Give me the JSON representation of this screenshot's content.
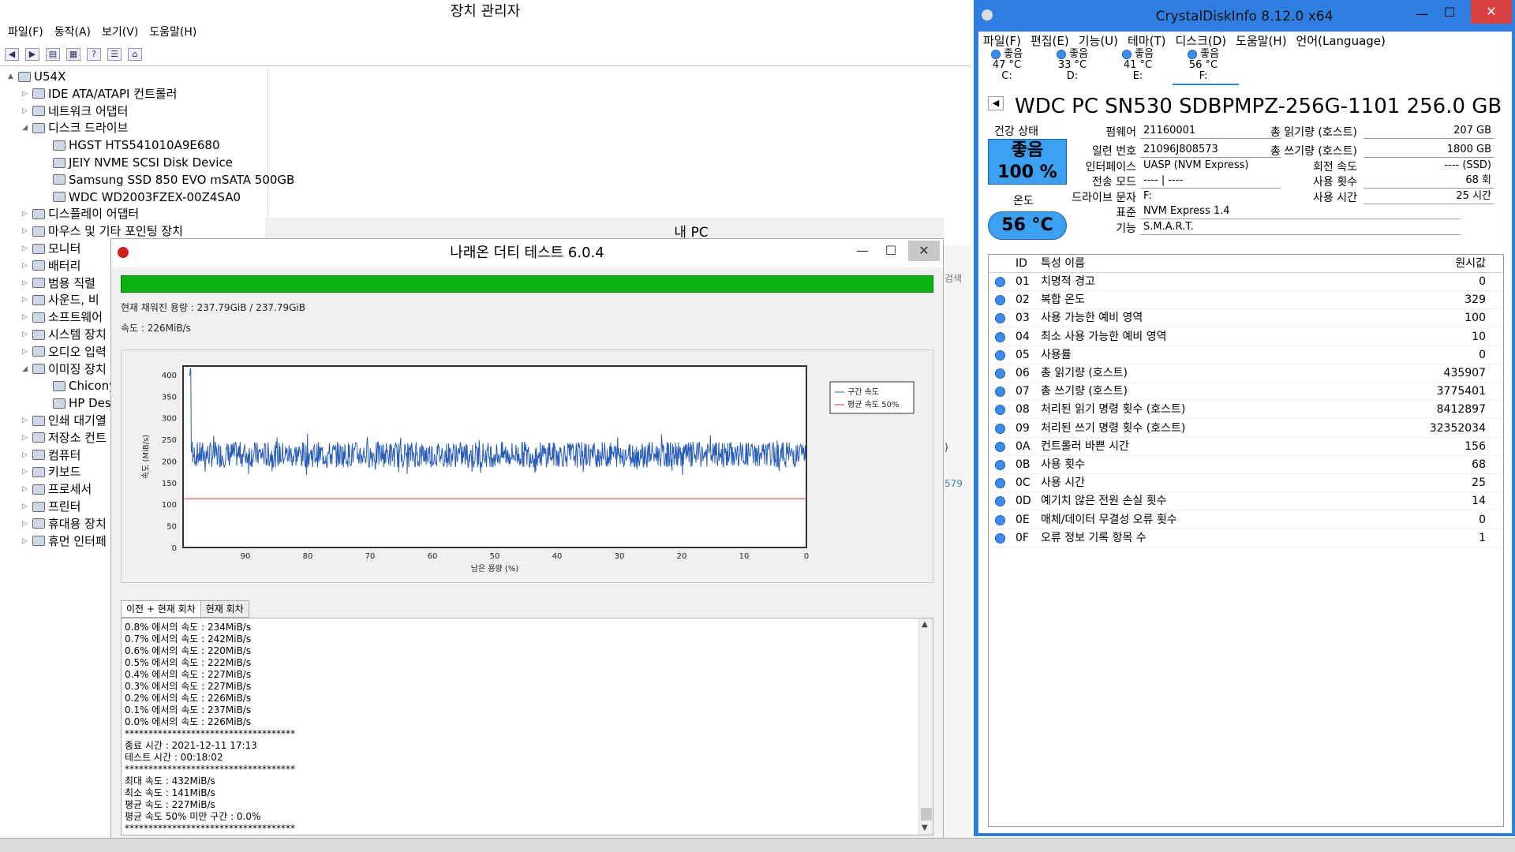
{
  "dm": {
    "title": "장치 관리자",
    "menu": [
      "파일(F)",
      "동작(A)",
      "보기(V)",
      "도움말(H)"
    ],
    "tree": [
      {
        "label": "U54X",
        "lvl": 0,
        "exp": "▲"
      },
      {
        "label": "IDE ATA/ATAPI 컨트롤러",
        "lvl": 1,
        "exp": "▷"
      },
      {
        "label": "네트워크 어댑터",
        "lvl": 1,
        "exp": "▷"
      },
      {
        "label": "디스크 드라이브",
        "lvl": 1,
        "exp": "◢"
      },
      {
        "label": "HGST HTS541010A9E680",
        "lvl": 2,
        "exp": ""
      },
      {
        "label": "JEIY NVME SCSI Disk Device",
        "lvl": 2,
        "exp": ""
      },
      {
        "label": "Samsung SSD 850 EVO mSATA 500GB",
        "lvl": 2,
        "exp": ""
      },
      {
        "label": "WDC WD2003FZEX-00Z4SA0",
        "lvl": 2,
        "exp": ""
      },
      {
        "label": "디스플레이 어댑터",
        "lvl": 1,
        "exp": "▷"
      },
      {
        "label": "마우스 및 기타 포인팅 장치",
        "lvl": 1,
        "exp": "▷"
      },
      {
        "label": "모니터",
        "lvl": 1,
        "exp": "▷"
      },
      {
        "label": "배터리",
        "lvl": 1,
        "exp": "▷"
      },
      {
        "label": "범용 직렬",
        "lvl": 1,
        "exp": "▷"
      },
      {
        "label": "사운드, 비",
        "lvl": 1,
        "exp": "▷"
      },
      {
        "label": "소프트웨어",
        "lvl": 1,
        "exp": "▷"
      },
      {
        "label": "시스템 장치",
        "lvl": 1,
        "exp": "▷"
      },
      {
        "label": "오디오 입력",
        "lvl": 1,
        "exp": "▷"
      },
      {
        "label": "이미징 장치",
        "lvl": 1,
        "exp": "◢"
      },
      {
        "label": "Chicony",
        "lvl": 2,
        "exp": ""
      },
      {
        "label": "HP Desk",
        "lvl": 2,
        "exp": ""
      },
      {
        "label": "인쇄 대기열",
        "lvl": 1,
        "exp": "▷"
      },
      {
        "label": "저장소 컨트",
        "lvl": 1,
        "exp": "▷"
      },
      {
        "label": "컴퓨터",
        "lvl": 1,
        "exp": "▷"
      },
      {
        "label": "키보드",
        "lvl": 1,
        "exp": "▷"
      },
      {
        "label": "프로세서",
        "lvl": 1,
        "exp": "▷"
      },
      {
        "label": "프린터",
        "lvl": 1,
        "exp": "▷"
      },
      {
        "label": "휴대용 장치",
        "lvl": 1,
        "exp": "▷"
      },
      {
        "label": "휴먼 인터페",
        "lvl": 1,
        "exp": "▷"
      }
    ]
  },
  "mypc": {
    "title": "내 PC",
    "side_text1": "검색",
    "side_text2": ")",
    "side_text3": "579"
  },
  "test": {
    "title": "나래온 더티 테스트 6.0.4",
    "filled": "현재 채워진 용량 : 237.79GiB / 237.79GiB",
    "speed": "속도 : 226MiB/s",
    "tabs": [
      "이전 + 현재 회차",
      "현재 회차"
    ],
    "log": [
      "0.8% 에서의 속도 : 234MiB/s",
      "0.7% 에서의 속도 : 242MiB/s",
      "0.6% 에서의 속도 : 220MiB/s",
      "0.5% 에서의 속도 : 222MiB/s",
      "0.4% 에서의 속도 : 227MiB/s",
      "0.3% 에서의 속도 : 227MiB/s",
      "0.2% 에서의 속도 : 226MiB/s",
      "0.1% 에서의 속도 : 237MiB/s",
      "0.0% 에서의 속도 : 226MiB/s",
      "************************************",
      "종료 시간 : 2021-12-11 17:13",
      "테스트 시간 : 00:18:02",
      "************************************",
      "최대 속도 : 432MiB/s",
      "최소 속도 : 141MiB/s",
      "평균 속도 : 227MiB/s",
      "평균 속도 50% 미만 구간 : 0.0%",
      "************************************"
    ]
  },
  "chart_data": {
    "type": "line",
    "xlabel": "남은 용량 (%)",
    "ylabel": "속도 (MiB/s)",
    "xlim": [
      100,
      0
    ],
    "ylim": [
      0,
      420
    ],
    "xticks": [
      90,
      80,
      70,
      60,
      50,
      40,
      30,
      20,
      10,
      0
    ],
    "yticks": [
      0,
      50,
      100,
      150,
      200,
      250,
      300,
      350,
      400
    ],
    "series": [
      {
        "name": "구간 속도",
        "color": "#2a5db8",
        "description_values": {
          "initial": 420,
          "steady_low": 185,
          "steady_high": 245,
          "steady_mean": 215
        }
      },
      {
        "name": "평균 속도 50%",
        "color": "#e03030",
        "values": [
          113
        ]
      }
    ],
    "legend": "right"
  },
  "cdi": {
    "title": "CrystalDiskInfo 8.12.0 x64",
    "menu": [
      "파일(F)",
      "편집(E)",
      "기능(U)",
      "테마(T)",
      "디스크(D)",
      "도움말(H)",
      "언어(Language)"
    ],
    "drives": [
      {
        "status": "좋음",
        "temp": "47 °C",
        "letter": "C:"
      },
      {
        "status": "좋음",
        "temp": "33 °C",
        "letter": "D:"
      },
      {
        "status": "좋음",
        "temp": "41 °C",
        "letter": "E:"
      },
      {
        "status": "좋음",
        "temp": "56 °C",
        "letter": "F:"
      }
    ],
    "model": "WDC PC SN530 SDBPMPZ-256G-1101 256.0 GB",
    "health_label": "건강 상태",
    "health_status": "좋음",
    "health_pct": "100 %",
    "temp_label": "온도",
    "temp": "56 °C",
    "fields": {
      "fw_l": "펌웨어",
      "fw": "21160001",
      "sn_l": "일련 번호",
      "sn": "21096J808573",
      "if_l": "인터페이스",
      "if": "UASP (NVM Express)",
      "tm_l": "전송 모드",
      "tm": "---- | ----",
      "dl_l": "드라이브 문자",
      "dl": "F:",
      "st_l": "표준",
      "st": "NVM Express 1.4",
      "fe_l": "기능",
      "fe": "S.M.A.R.T.",
      "hr_l": "총 읽기량 (호스트)",
      "hr": "207 GB",
      "hw_l": "총 쓰기량 (호스트)",
      "hw": "1800 GB",
      "rot_l": "회전 속도",
      "rot": "---- (SSD)",
      "pc_l": "사용 횟수",
      "pc": "68 회",
      "ph_l": "사용 시간",
      "ph": "25 시간"
    },
    "smart_head": {
      "id": "ID",
      "name": "특성 이름",
      "raw": "원시값"
    },
    "smart": [
      [
        "01",
        "치명적 경고",
        "0"
      ],
      [
        "02",
        "복합 온도",
        "329"
      ],
      [
        "03",
        "사용 가능한 예비 영역",
        "100"
      ],
      [
        "04",
        "최소 사용 가능한 예비 영역",
        "10"
      ],
      [
        "05",
        "사용률",
        "0"
      ],
      [
        "06",
        "총 읽기량 (호스트)",
        "435907"
      ],
      [
        "07",
        "총 쓰기량 (호스트)",
        "3775401"
      ],
      [
        "08",
        "처리된 읽기 명령 횟수 (호스트)",
        "8412897"
      ],
      [
        "09",
        "처리된 쓰기 명령 횟수 (호스트)",
        "32352034"
      ],
      [
        "0A",
        "컨트롤러 바쁜 시간",
        "156"
      ],
      [
        "0B",
        "사용 횟수",
        "68"
      ],
      [
        "0C",
        "사용 시간",
        "25"
      ],
      [
        "0D",
        "예기치 않은 전원 손실 횟수",
        "14"
      ],
      [
        "0E",
        "매체/데이터 무결성 오류 횟수",
        "0"
      ],
      [
        "0F",
        "오류 정보 기록 항목 수",
        "1"
      ]
    ]
  }
}
